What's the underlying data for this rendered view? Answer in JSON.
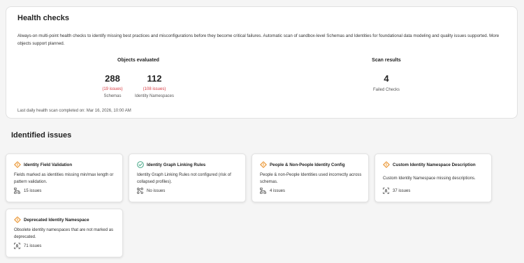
{
  "health": {
    "title": "Health checks",
    "description": "Always-on multi-point health checks to identify missing best practices and misconfigurations before they become critical failures. Automatic scan of sandbox-level Schemas and Identities for foundational data modeling and quality issues supported. More objects support planned.",
    "objects_heading": "Objects evaluated",
    "stats": [
      {
        "value": "288",
        "issues": "(19 issues)",
        "label": "Schemas"
      },
      {
        "value": "112",
        "issues": "(108 issues)",
        "label": "Identity Namespaces"
      }
    ],
    "scan_heading": "Scan results",
    "scan": {
      "value": "4",
      "label": "Failed Checks"
    },
    "footnote": "Last daily health scan completed on: Mar 16, 2026, 10:00 AM"
  },
  "issues_title": "Identified issues",
  "cards": [
    {
      "title": "Identity Field Validation",
      "status_icon": "warning-icon",
      "description": "Fields marked as identities missing min/max length or pattern validation.",
      "count_icon": "schema-icon",
      "count": "15 issues"
    },
    {
      "title": "Identity Graph Linking Rules",
      "status_icon": "check-circle-icon",
      "description": "Identity Graph Linking Rules not configured (risk of collapsed profiles).",
      "count_icon": "graph-icon",
      "count": "No issues"
    },
    {
      "title": "People & Non-People Identity Config",
      "status_icon": "warning-icon",
      "description": "People & non-People Identities used incorrectly across schemas.",
      "count_icon": "schema-icon",
      "count": "4 issues"
    },
    {
      "title": "Custom Identity Namespace Description",
      "status_icon": "warning-icon",
      "description": "Custom Identity Namespace missing descriptions.",
      "count_icon": "identity-icon",
      "count": "37 issues"
    },
    {
      "title": "Deprecated Identity Namespace",
      "status_icon": "warning-icon",
      "description": "Obsolete identity namespaces that are not marked as deprecated.",
      "count_icon": "identity-icon",
      "count": "71 issues"
    }
  ],
  "colors": {
    "warning": "#e68619",
    "success": "#2d9d78",
    "issues_text": "#d7373f"
  }
}
